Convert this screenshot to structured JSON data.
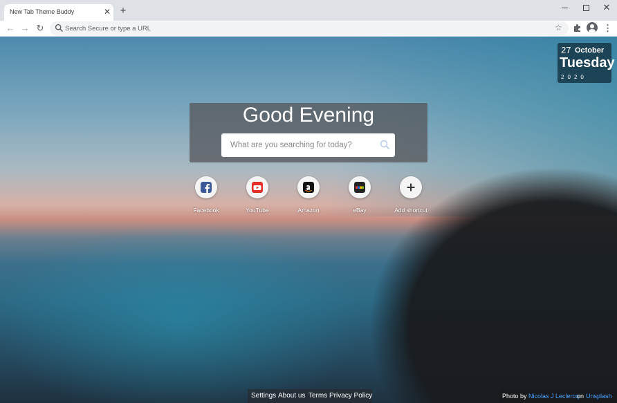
{
  "browser": {
    "tab_title": "New Tab Theme Buddy",
    "tab_close": "✕",
    "new_tab": "+",
    "omnibox_placeholder": "Search Secure or type a URL",
    "window_close": "✕",
    "star": "☆",
    "menu": "⋮",
    "back": "←",
    "forward": "→",
    "reload": "↻"
  },
  "date": {
    "day": "27",
    "month": "October",
    "weekday": "Tuesday",
    "year": "2020"
  },
  "greeting": "Good Evening",
  "search": {
    "placeholder": "What are you searching for today?"
  },
  "shortcuts": [
    {
      "label": "Facebook",
      "icon": "facebook-icon",
      "color": "#3b5998"
    },
    {
      "label": "YouTube",
      "icon": "youtube-icon",
      "color": "#e52d27"
    },
    {
      "label": "Amazon",
      "icon": "amazon-icon",
      "color": "#111111"
    },
    {
      "label": "eBay",
      "icon": "ebay-icon",
      "color": "#222222"
    },
    {
      "label": "Add shortcut",
      "icon": "plus-icon",
      "color": "#333333"
    }
  ],
  "footer": {
    "settings": "Settings",
    "about": "About us",
    "terms": "Terms",
    "privacy": "Privacy Policy"
  },
  "credit": {
    "prefix": "Photo by",
    "author": "Nicolas J Leclercq",
    "on": "on",
    "site": "Unsplash"
  }
}
